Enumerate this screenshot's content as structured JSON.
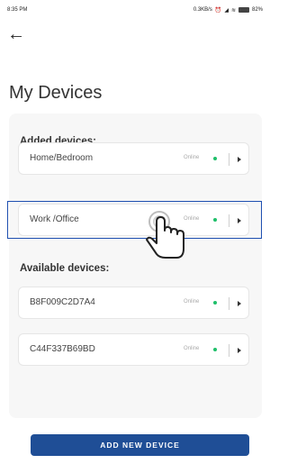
{
  "status_bar": {
    "time": "8:35 PM",
    "network_speed": "0.3KB/s",
    "battery": "82%"
  },
  "header": {
    "back_icon": "arrow-left-icon",
    "title": "My Devices"
  },
  "added": {
    "label": "Added devices:",
    "devices": [
      {
        "name": "Home/Bedroom",
        "status": "Online"
      },
      {
        "name": "Work /Office",
        "status": "Online"
      }
    ]
  },
  "available": {
    "label": "Available devices:",
    "devices": [
      {
        "name": "B8F009C2D7A4",
        "status": "Online"
      },
      {
        "name": "C44F337B69BD",
        "status": "Online"
      }
    ]
  },
  "actions": {
    "add_label": "ADD NEW DEVICE"
  },
  "colors": {
    "accent": "#1f4e96",
    "online": "#1fbf6a",
    "highlight": "#1e4fb0"
  }
}
